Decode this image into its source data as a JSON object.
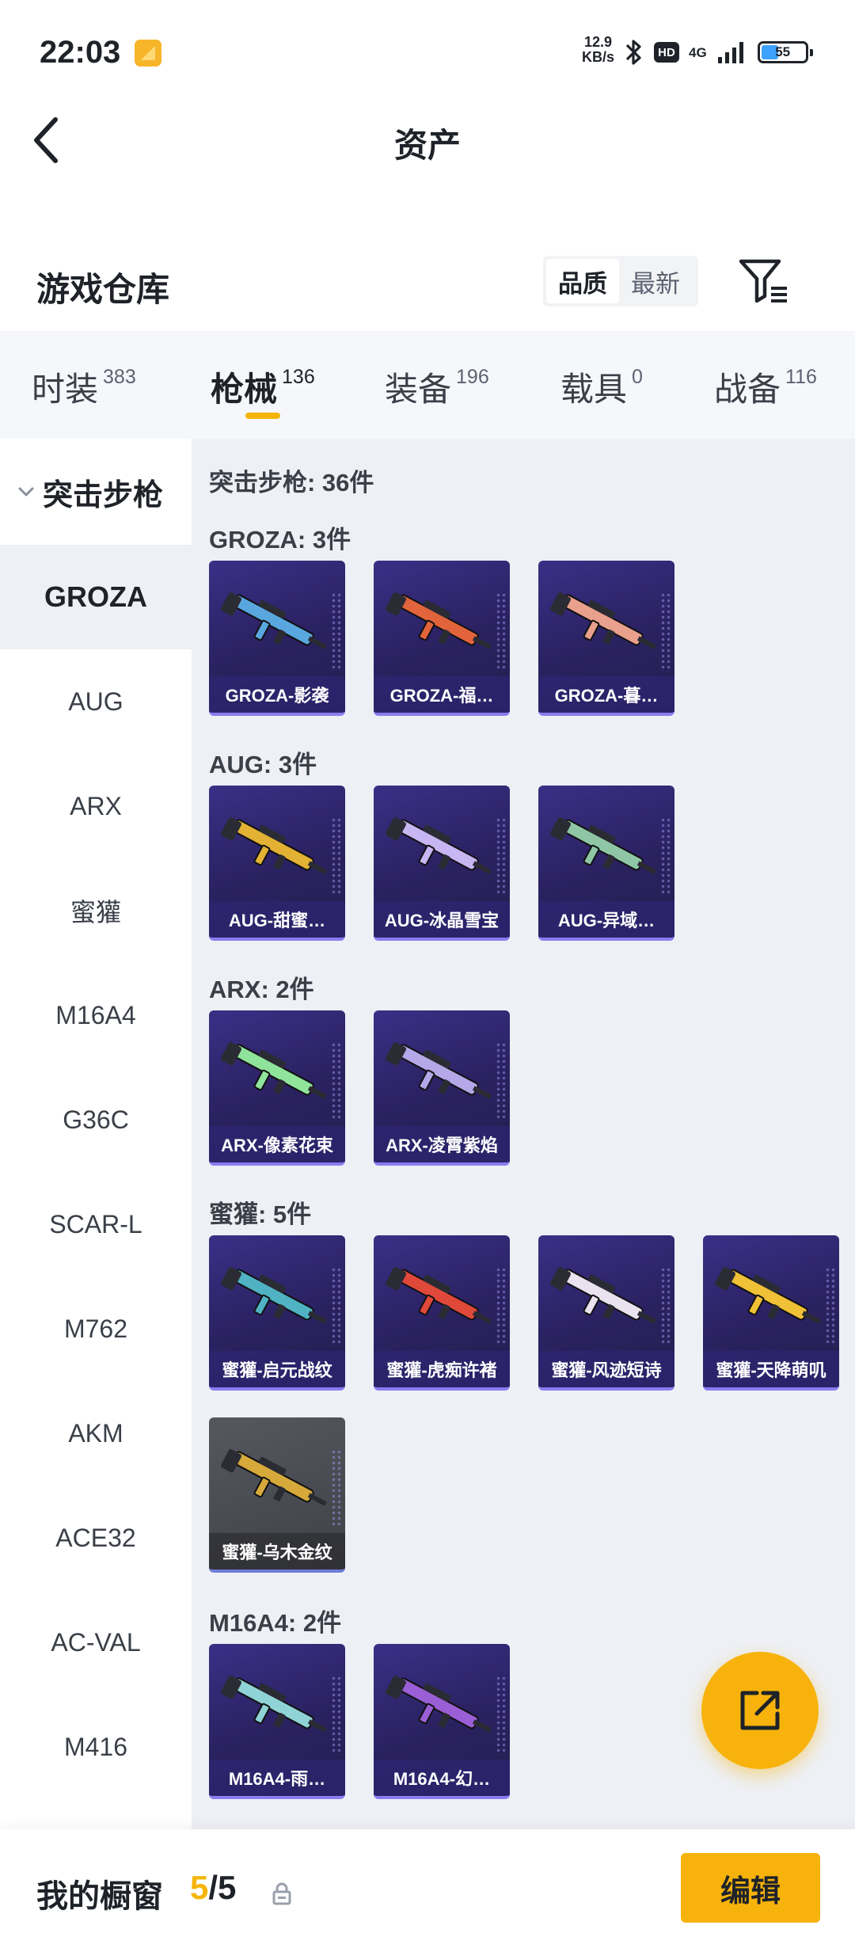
{
  "status_bar": {
    "time": "22:03",
    "speed_value": "12.9",
    "speed_unit": "KB/s",
    "hd": "HD",
    "network": "4G",
    "battery": "55"
  },
  "header": {
    "title": "资产"
  },
  "warehouse": {
    "title": "游戏仓库",
    "sort_options": [
      "品质",
      "最新"
    ],
    "active_sort": "品质"
  },
  "tabs": [
    {
      "label": "时装",
      "count": "383"
    },
    {
      "label": "枪械",
      "count": "136"
    },
    {
      "label": "装备",
      "count": "196"
    },
    {
      "label": "载具",
      "count": "0"
    },
    {
      "label": "战备",
      "count": "116"
    }
  ],
  "active_tab": "枪械",
  "sidebar": {
    "category": "突击步枪",
    "items": [
      "GROZA",
      "AUG",
      "ARX",
      "蜜獾",
      "M16A4",
      "G36C",
      "SCAR-L",
      "M762",
      "AKM",
      "ACE32",
      "AC-VAL",
      "M416"
    ],
    "active": "GROZA"
  },
  "main": {
    "summary": "突击步枪: 36件",
    "groups": [
      {
        "title": "GROZA: 3件",
        "items": [
          {
            "name": "GROZA-影袭",
            "color": "#5aa7e0"
          },
          {
            "name": "GROZA-福…",
            "color": "#e2643c"
          },
          {
            "name": "GROZA-暮…",
            "color": "#e9a08c"
          }
        ]
      },
      {
        "title": "AUG: 3件",
        "items": [
          {
            "name": "AUG-甜蜜…",
            "color": "#e3b234"
          },
          {
            "name": "AUG-冰晶雪宝",
            "color": "#c7b6f2"
          },
          {
            "name": "AUG-异域…",
            "color": "#8fc7a6"
          }
        ]
      },
      {
        "title": "ARX: 2件",
        "items": [
          {
            "name": "ARX-像素花束",
            "color": "#8fe39b"
          },
          {
            "name": "ARX-凌霄紫焰",
            "color": "#b5a8e8"
          }
        ]
      },
      {
        "title": "蜜獾: 5件",
        "items": [
          {
            "name": "蜜獾-启元战纹",
            "color": "#4fb3c4"
          },
          {
            "name": "蜜獾-虎痴许褚",
            "color": "#e0493a"
          },
          {
            "name": "蜜獾-风迹短诗",
            "color": "#eae2ee"
          },
          {
            "name": "蜜獾-天降萌叽",
            "color": "#f0c036"
          },
          {
            "name": "蜜獾-乌木金纹",
            "color": "#d6a93a",
            "style": "gray"
          }
        ]
      },
      {
        "title": "M16A4: 2件",
        "items": [
          {
            "name": "M16A4-雨…",
            "color": "#8fd3d6"
          },
          {
            "name": "M16A4-幻…",
            "color": "#9a5fd6"
          }
        ]
      }
    ]
  },
  "bottom_bar": {
    "label": "我的橱窗",
    "current": "5",
    "total": "5",
    "edit_label": "编辑"
  }
}
